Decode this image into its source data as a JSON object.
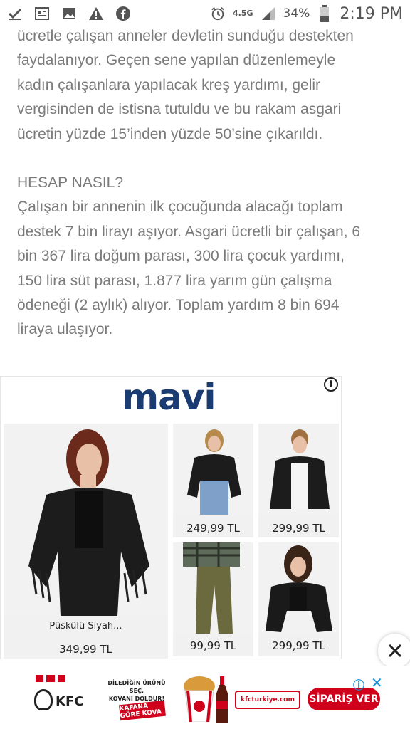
{
  "status_bar": {
    "network": "4.5G",
    "battery": "34%",
    "time": "2:19 PM"
  },
  "article": {
    "para1_lines": [
      "ücretle çalışan anneler devletin sunduğu destekten",
      "faydalanıyor. Geçen sene yapılan düzenlemeyle",
      "kadın çalışanlara yapılacak kreş yardımı, gelir",
      "vergisinden de istisna tutuldu ve bu rakam asgari",
      "ücretin yüzde 15’inden yüzde 50’sine çıkarıldı."
    ],
    "heading": "HESAP NASIL?",
    "para2_lines": [
      "Çalışan bir annenin ilk çocuğunda alacağı toplam",
      "destek 7 bin lirayı aşıyor. Asgari ücretli bir çalışan, 6",
      "bin 367 lira doğum parası, 300 lira çocuk yardımı,",
      "150 lira süt parası, 1.877 lira yarım gün çalışma",
      "ödeneği (2 aylık) alıyor. Toplam yardım 8 bin 694",
      "liraya ulaşıyor."
    ]
  },
  "ad": {
    "brand": "mavi",
    "info_glyph": "i",
    "products": [
      {
        "name": "Püskülü Siyah...",
        "price": "349,99 TL"
      },
      {
        "name": "",
        "price": "249,99 TL"
      },
      {
        "name": "",
        "price": "299,99 TL"
      },
      {
        "name": "",
        "price": "99,99 TL"
      },
      {
        "name": "",
        "price": "299,99 TL"
      }
    ]
  },
  "banner": {
    "brand": "KFC",
    "promo_line1": "DİLEDİĞİN ÜRÜNÜ SEÇ,",
    "promo_line2": "KOVANI DOLDUR!",
    "promo_tag": "KAFANA GÖRE KOVA",
    "site": "kfcturkiye.com",
    "cta": "SİPARİŞ VER",
    "adchoices": "ⓘ",
    "close": "✕"
  },
  "colors": {
    "text": "#7a7a7a",
    "mavi_blue": "#1b3b73",
    "kfc_red": "#d0021b",
    "adchoice_blue": "#1a8fd9"
  }
}
